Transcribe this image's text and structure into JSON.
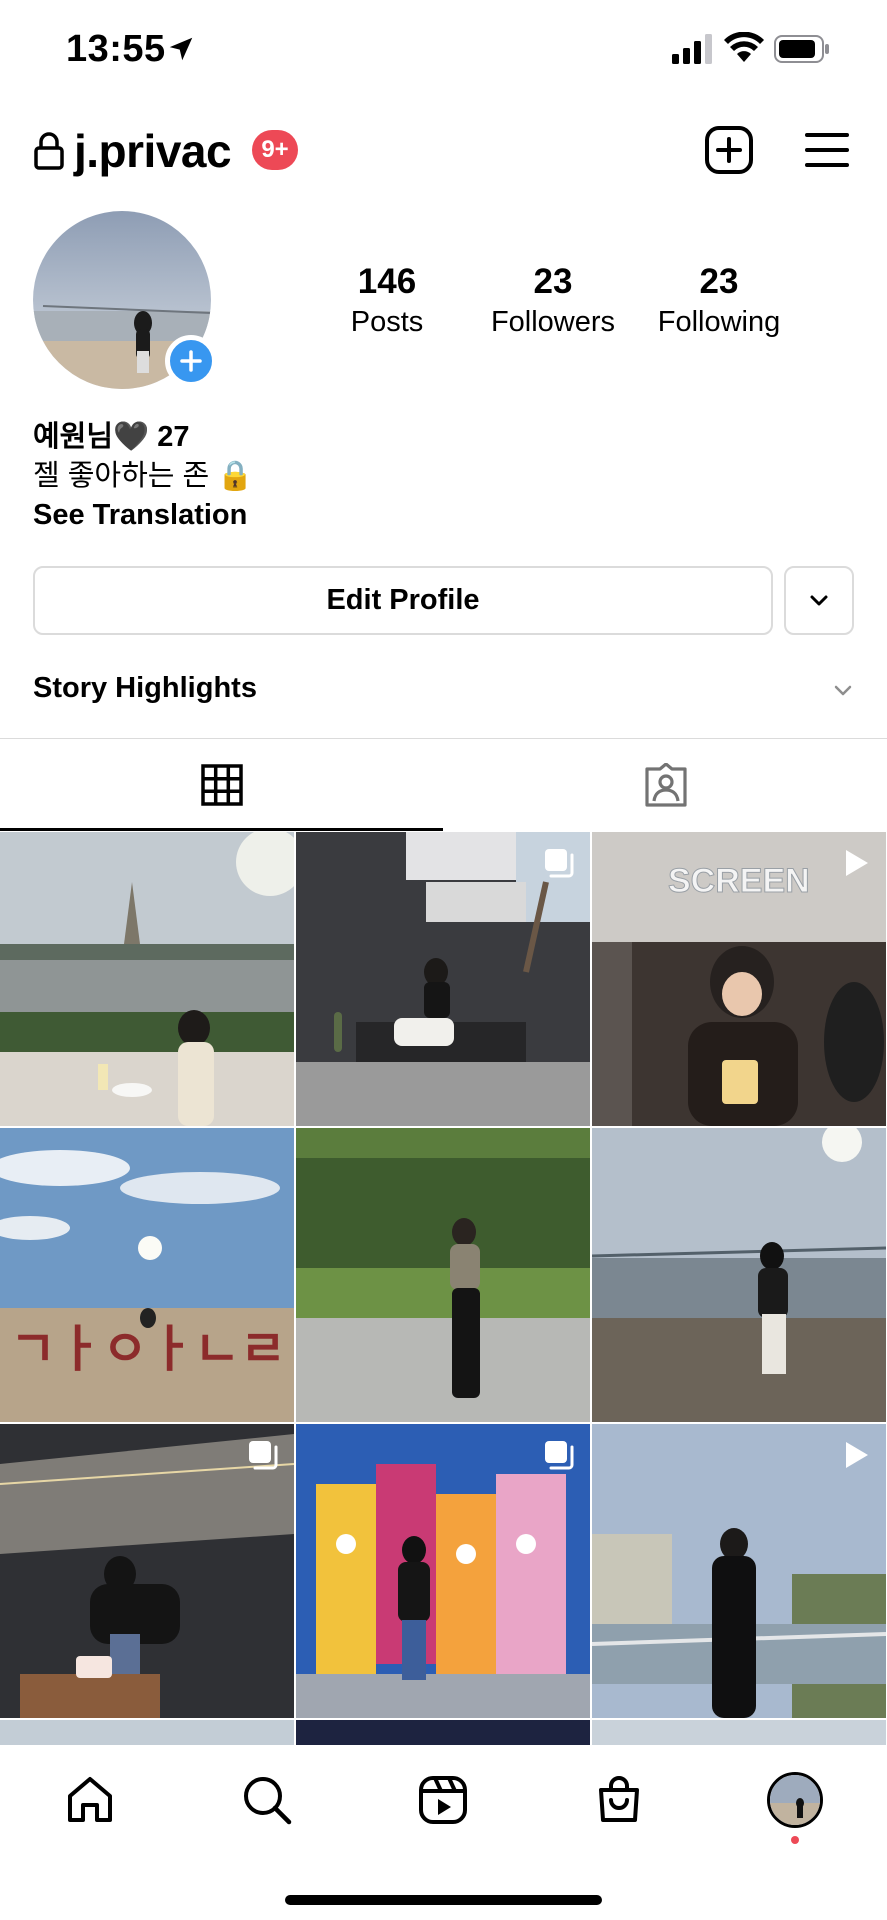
{
  "status_bar": {
    "time": "13:55"
  },
  "header": {
    "username": "j.privac",
    "notification_badge": "9+"
  },
  "profile": {
    "stats": [
      {
        "value": "146",
        "label": "Posts"
      },
      {
        "value": "23",
        "label": "Followers"
      },
      {
        "value": "23",
        "label": "Following"
      }
    ],
    "bio": {
      "name_line": "예원님🖤 27",
      "description": "젤 좋아하는 존 🔒",
      "see_translation": "See Translation"
    },
    "edit_profile_label": "Edit Profile",
    "story_highlights_label": "Story Highlights"
  },
  "tabs": [
    {
      "name": "grid-icon",
      "active": true
    },
    {
      "name": "tagged-icon",
      "active": false
    }
  ],
  "grid": {
    "posts": [
      {
        "scene": "riverside-temple",
        "badge": "none"
      },
      {
        "scene": "bench-white-pants",
        "badge": "multiple-photos-icon"
      },
      {
        "scene": "cinema-popcorn",
        "badge": "reel-icon"
      },
      {
        "scene": "beach-sign",
        "badge": "none"
      },
      {
        "scene": "hedge-wall",
        "badge": "none"
      },
      {
        "scene": "beach-bridge",
        "badge": "none"
      },
      {
        "scene": "rooftop-birthday",
        "badge": "multiple-photos-icon"
      },
      {
        "scene": "graffiti-wall",
        "badge": "multiple-photos-icon"
      },
      {
        "scene": "hillside-village",
        "badge": "reel-icon"
      }
    ]
  },
  "bottom_nav": [
    {
      "name": "home-icon"
    },
    {
      "name": "search-icon"
    },
    {
      "name": "reels-icon"
    },
    {
      "name": "shop-icon"
    },
    {
      "name": "profile-avatar"
    }
  ]
}
